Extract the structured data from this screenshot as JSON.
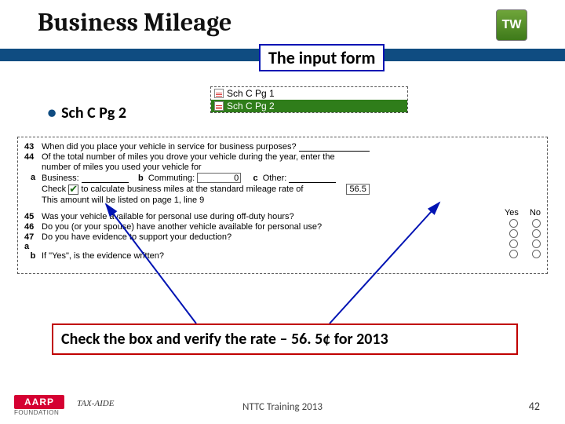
{
  "header": {
    "title": "Business Mileage",
    "badge": "TW",
    "input_form_label": "The input form"
  },
  "bullet": {
    "text": "Sch  C Pg 2"
  },
  "tabs": {
    "row1": "Sch C Pg 1",
    "row2": "Sch C Pg 2"
  },
  "form": {
    "l43": {
      "num": "43",
      "text": "When did you place your vehicle in service for business purposes?"
    },
    "l44": {
      "num": "44",
      "text1": "Of the total number of miles you drove your vehicle during the year, enter the",
      "text2": "number of miles you used your vehicle for"
    },
    "la": {
      "sub": "a",
      "label": "Business:",
      "b_lbl": "b",
      "b_txt": "Commuting:",
      "b_val": "0",
      "c_lbl": "c",
      "c_txt": "Other:"
    },
    "lchk": {
      "pre": "Check",
      "post": "to calculate business miles at the standard mileage rate of",
      "rate": "56.5"
    },
    "lamt": {
      "text": "This amount will be listed on page 1, line 9"
    },
    "l45": {
      "num": "45",
      "text": "Was your vehicle available for personal use during off-duty hours?"
    },
    "l46": {
      "num": "46",
      "text": "Do you (or your spouse) have another vehicle available for personal use?"
    },
    "l47a": {
      "num": "47 a",
      "text": "Do you have evidence to support your deduction?"
    },
    "l47b": {
      "sub": "b",
      "text": "If \"Yes\", is the evidence written?"
    },
    "yes": "Yes",
    "no": "No"
  },
  "note": "Check the box and verify the rate – 56. 5¢ for 2013",
  "footer": {
    "aarp": "AARP",
    "foundation": "FOUNDATION",
    "taxaide": "TAX-AIDE",
    "center": "NTTC Training 2013",
    "page": "42"
  }
}
